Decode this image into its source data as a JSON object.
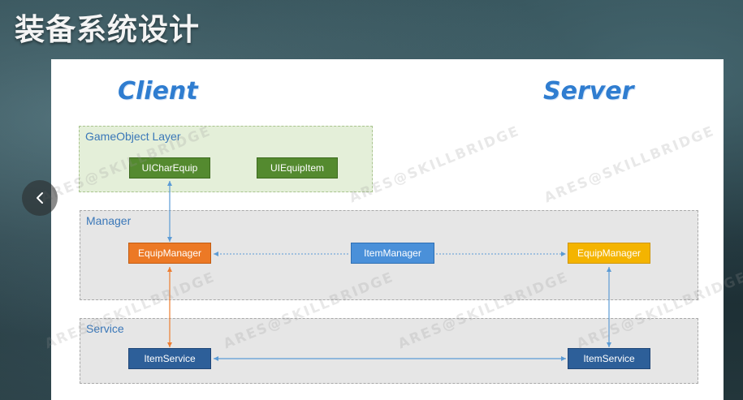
{
  "title": "装备系统设计",
  "headings": {
    "client": "Client",
    "server": "Server"
  },
  "layers": {
    "gameobject": "GameObject Layer",
    "manager": "Manager",
    "service": "Service"
  },
  "nodes": {
    "ui_char_equip": "UICharEquip",
    "ui_equip_item": "UIEquipItem",
    "client_equip_manager": "EquipManager",
    "item_manager": "ItemManager",
    "server_equip_manager": "EquipManager",
    "client_item_service": "ItemService",
    "server_item_service": "ItemService"
  },
  "watermark": "ARES@SKILLBRIDGE",
  "colors": {
    "heading": "#2f7dd0",
    "green": "#548a2f",
    "orange": "#ec7925",
    "blue": "#4a90d9",
    "yellow": "#f4b400",
    "navy": "#2d5f99",
    "connector_blue": "#5b9bd5",
    "connector_orange": "#ed7d31"
  },
  "icons": {
    "prev": "chevron-left-icon"
  }
}
